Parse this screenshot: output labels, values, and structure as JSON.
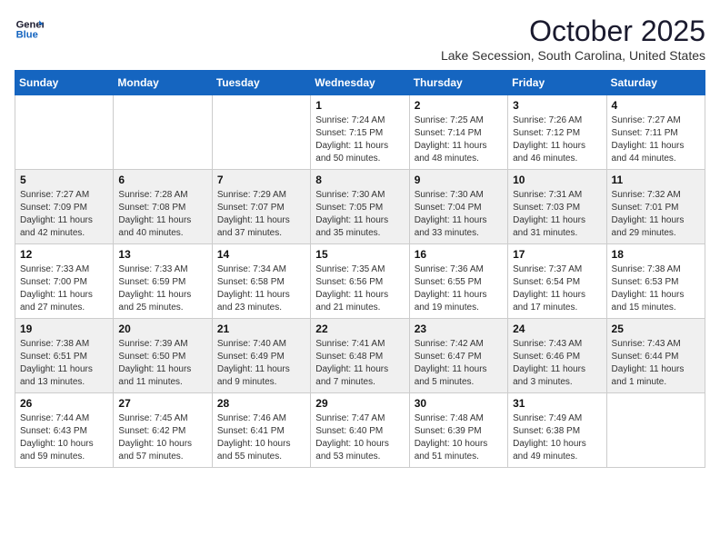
{
  "logo": {
    "line1": "General",
    "line2": "Blue"
  },
  "title": "October 2025",
  "location": "Lake Secession, South Carolina, United States",
  "weekdays": [
    "Sunday",
    "Monday",
    "Tuesday",
    "Wednesday",
    "Thursday",
    "Friday",
    "Saturday"
  ],
  "weeks": [
    [
      {
        "day": "",
        "info": ""
      },
      {
        "day": "",
        "info": ""
      },
      {
        "day": "",
        "info": ""
      },
      {
        "day": "1",
        "info": "Sunrise: 7:24 AM\nSunset: 7:15 PM\nDaylight: 11 hours\nand 50 minutes."
      },
      {
        "day": "2",
        "info": "Sunrise: 7:25 AM\nSunset: 7:14 PM\nDaylight: 11 hours\nand 48 minutes."
      },
      {
        "day": "3",
        "info": "Sunrise: 7:26 AM\nSunset: 7:12 PM\nDaylight: 11 hours\nand 46 minutes."
      },
      {
        "day": "4",
        "info": "Sunrise: 7:27 AM\nSunset: 7:11 PM\nDaylight: 11 hours\nand 44 minutes."
      }
    ],
    [
      {
        "day": "5",
        "info": "Sunrise: 7:27 AM\nSunset: 7:09 PM\nDaylight: 11 hours\nand 42 minutes."
      },
      {
        "day": "6",
        "info": "Sunrise: 7:28 AM\nSunset: 7:08 PM\nDaylight: 11 hours\nand 40 minutes."
      },
      {
        "day": "7",
        "info": "Sunrise: 7:29 AM\nSunset: 7:07 PM\nDaylight: 11 hours\nand 37 minutes."
      },
      {
        "day": "8",
        "info": "Sunrise: 7:30 AM\nSunset: 7:05 PM\nDaylight: 11 hours\nand 35 minutes."
      },
      {
        "day": "9",
        "info": "Sunrise: 7:30 AM\nSunset: 7:04 PM\nDaylight: 11 hours\nand 33 minutes."
      },
      {
        "day": "10",
        "info": "Sunrise: 7:31 AM\nSunset: 7:03 PM\nDaylight: 11 hours\nand 31 minutes."
      },
      {
        "day": "11",
        "info": "Sunrise: 7:32 AM\nSunset: 7:01 PM\nDaylight: 11 hours\nand 29 minutes."
      }
    ],
    [
      {
        "day": "12",
        "info": "Sunrise: 7:33 AM\nSunset: 7:00 PM\nDaylight: 11 hours\nand 27 minutes."
      },
      {
        "day": "13",
        "info": "Sunrise: 7:33 AM\nSunset: 6:59 PM\nDaylight: 11 hours\nand 25 minutes."
      },
      {
        "day": "14",
        "info": "Sunrise: 7:34 AM\nSunset: 6:58 PM\nDaylight: 11 hours\nand 23 minutes."
      },
      {
        "day": "15",
        "info": "Sunrise: 7:35 AM\nSunset: 6:56 PM\nDaylight: 11 hours\nand 21 minutes."
      },
      {
        "day": "16",
        "info": "Sunrise: 7:36 AM\nSunset: 6:55 PM\nDaylight: 11 hours\nand 19 minutes."
      },
      {
        "day": "17",
        "info": "Sunrise: 7:37 AM\nSunset: 6:54 PM\nDaylight: 11 hours\nand 17 minutes."
      },
      {
        "day": "18",
        "info": "Sunrise: 7:38 AM\nSunset: 6:53 PM\nDaylight: 11 hours\nand 15 minutes."
      }
    ],
    [
      {
        "day": "19",
        "info": "Sunrise: 7:38 AM\nSunset: 6:51 PM\nDaylight: 11 hours\nand 13 minutes."
      },
      {
        "day": "20",
        "info": "Sunrise: 7:39 AM\nSunset: 6:50 PM\nDaylight: 11 hours\nand 11 minutes."
      },
      {
        "day": "21",
        "info": "Sunrise: 7:40 AM\nSunset: 6:49 PM\nDaylight: 11 hours\nand 9 minutes."
      },
      {
        "day": "22",
        "info": "Sunrise: 7:41 AM\nSunset: 6:48 PM\nDaylight: 11 hours\nand 7 minutes."
      },
      {
        "day": "23",
        "info": "Sunrise: 7:42 AM\nSunset: 6:47 PM\nDaylight: 11 hours\nand 5 minutes."
      },
      {
        "day": "24",
        "info": "Sunrise: 7:43 AM\nSunset: 6:46 PM\nDaylight: 11 hours\nand 3 minutes."
      },
      {
        "day": "25",
        "info": "Sunrise: 7:43 AM\nSunset: 6:44 PM\nDaylight: 11 hours\nand 1 minute."
      }
    ],
    [
      {
        "day": "26",
        "info": "Sunrise: 7:44 AM\nSunset: 6:43 PM\nDaylight: 10 hours\nand 59 minutes."
      },
      {
        "day": "27",
        "info": "Sunrise: 7:45 AM\nSunset: 6:42 PM\nDaylight: 10 hours\nand 57 minutes."
      },
      {
        "day": "28",
        "info": "Sunrise: 7:46 AM\nSunset: 6:41 PM\nDaylight: 10 hours\nand 55 minutes."
      },
      {
        "day": "29",
        "info": "Sunrise: 7:47 AM\nSunset: 6:40 PM\nDaylight: 10 hours\nand 53 minutes."
      },
      {
        "day": "30",
        "info": "Sunrise: 7:48 AM\nSunset: 6:39 PM\nDaylight: 10 hours\nand 51 minutes."
      },
      {
        "day": "31",
        "info": "Sunrise: 7:49 AM\nSunset: 6:38 PM\nDaylight: 10 hours\nand 49 minutes."
      },
      {
        "day": "",
        "info": ""
      }
    ]
  ]
}
